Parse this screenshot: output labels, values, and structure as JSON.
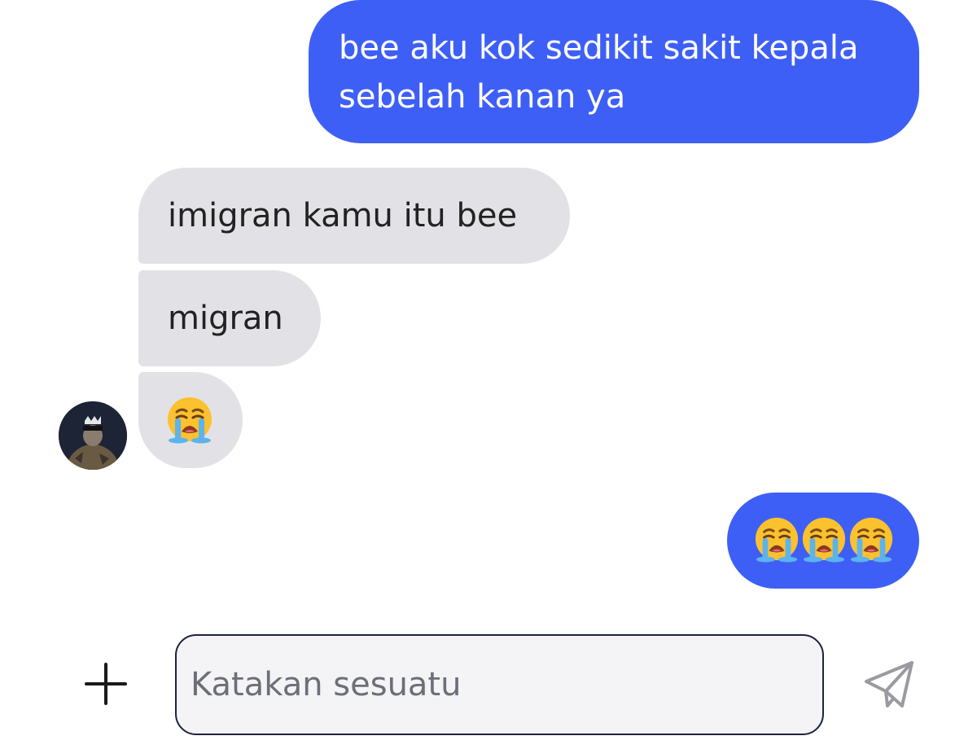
{
  "messages": [
    {
      "direction": "sent",
      "text": "bee aku kok sedikit sakit kepala sebelah kanan ya"
    },
    {
      "direction": "received",
      "text": "imigran kamu itu bee"
    },
    {
      "direction": "received",
      "text": "migran"
    },
    {
      "direction": "received",
      "emoji": [
        "loudly-crying-face"
      ]
    },
    {
      "direction": "sent",
      "emoji": [
        "loudly-crying-face",
        "loudly-crying-face",
        "loudly-crying-face"
      ]
    }
  ],
  "composer": {
    "placeholder": "Katakan sesuatu",
    "value": ""
  },
  "icons": {
    "add": "plus-icon",
    "send": "send-icon",
    "avatar": "avatar"
  },
  "colors": {
    "sent_bubble": "#3e5ff6",
    "received_bubble": "#e2e2e6",
    "input_border": "#1b2340"
  }
}
